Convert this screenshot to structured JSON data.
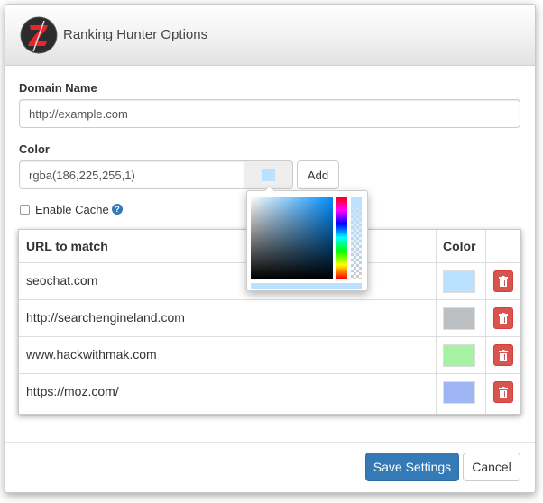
{
  "header": {
    "title": "Ranking Hunter Options",
    "logo_icon": "z-logo-icon"
  },
  "form": {
    "domain_label": "Domain Name",
    "domain_value": "http://example.com",
    "color_label": "Color",
    "color_value": "rgba(186,225,255,1)",
    "color_swatch": "#bae1ff",
    "add_label": "Add",
    "cache_label": "Enable Cache",
    "help_glyph": "?"
  },
  "table": {
    "headers": {
      "url": "URL to match",
      "color": "Color"
    },
    "rows": [
      {
        "url": "seochat.com",
        "color": "#bae1ff"
      },
      {
        "url": "http://searchengineland.com",
        "color": "#bdc0c2"
      },
      {
        "url": "www.hackwithmak.com",
        "color": "#a5f2a5"
      },
      {
        "url": "https://moz.com/",
        "color": "#9fb6f5"
      }
    ]
  },
  "footer": {
    "save_label": "Save Settings",
    "cancel_label": "Cancel"
  },
  "colors": {
    "primary": "#337ab7",
    "danger": "#d9534f"
  }
}
